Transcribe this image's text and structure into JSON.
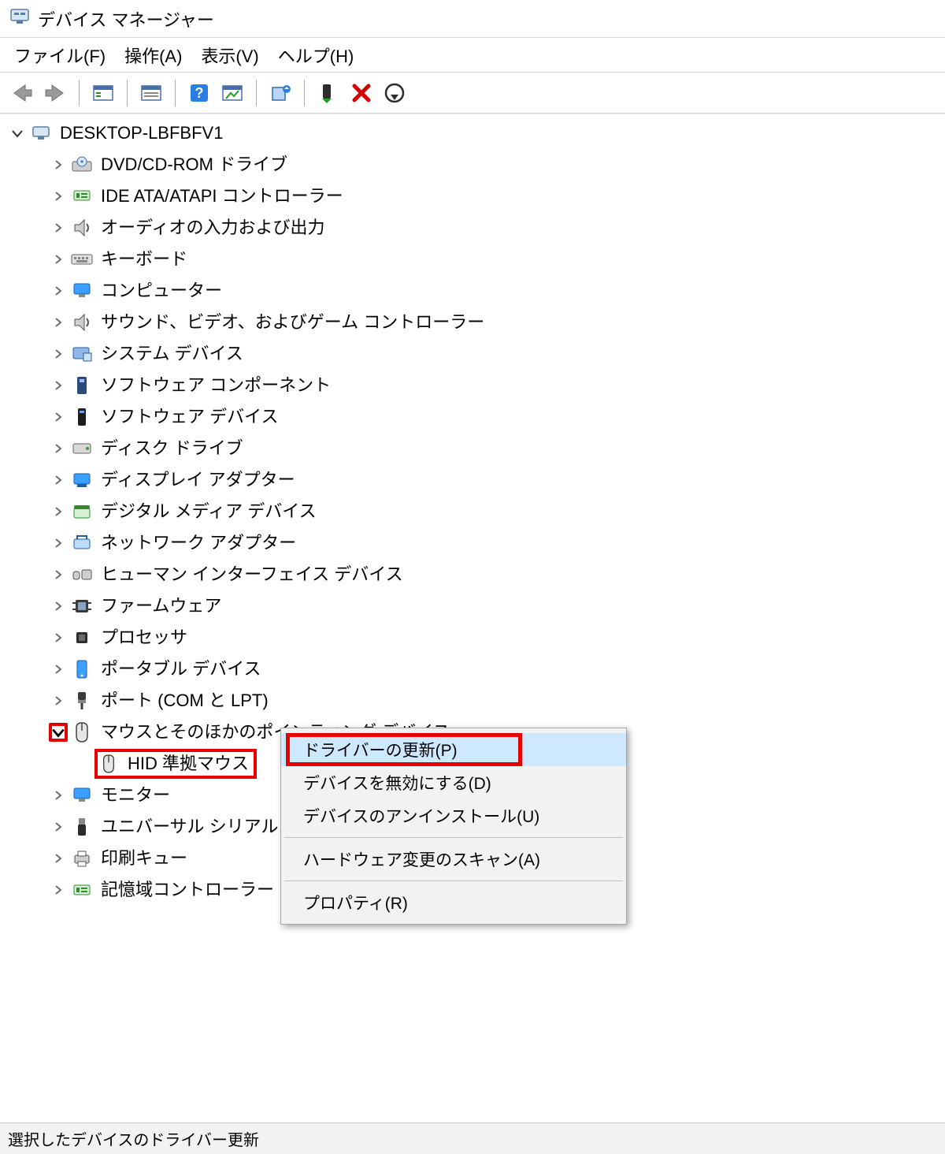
{
  "window": {
    "title": "デバイス マネージャー"
  },
  "menu": {
    "file": "ファイル(F)",
    "action": "操作(A)",
    "view": "表示(V)",
    "help": "ヘルプ(H)"
  },
  "statusbar": {
    "text": "選択したデバイスのドライバー更新"
  },
  "tree": {
    "root": "DESKTOP-LBFBFV1",
    "items": [
      {
        "label": "DVD/CD-ROM ドライブ",
        "icon": "disc-drive-icon"
      },
      {
        "label": "IDE ATA/ATAPI コントローラー",
        "icon": "ide-controller-icon"
      },
      {
        "label": "オーディオの入力および出力",
        "icon": "speaker-icon"
      },
      {
        "label": "キーボード",
        "icon": "keyboard-icon"
      },
      {
        "label": "コンピューター",
        "icon": "computer-icon"
      },
      {
        "label": "サウンド、ビデオ、およびゲーム コントローラー",
        "icon": "speaker-icon"
      },
      {
        "label": "システム デバイス",
        "icon": "system-device-icon"
      },
      {
        "label": "ソフトウェア コンポーネント",
        "icon": "software-component-icon"
      },
      {
        "label": "ソフトウェア デバイス",
        "icon": "software-device-icon"
      },
      {
        "label": "ディスク ドライブ",
        "icon": "disk-drive-icon"
      },
      {
        "label": "ディスプレイ アダプター",
        "icon": "display-adapter-icon"
      },
      {
        "label": "デジタル メディア デバイス",
        "icon": "media-device-icon"
      },
      {
        "label": "ネットワーク アダプター",
        "icon": "network-adapter-icon"
      },
      {
        "label": "ヒューマン インターフェイス デバイス",
        "icon": "hid-icon"
      },
      {
        "label": "ファームウェア",
        "icon": "firmware-icon"
      },
      {
        "label": "プロセッサ",
        "icon": "processor-icon"
      },
      {
        "label": "ポータブル デバイス",
        "icon": "portable-device-icon"
      },
      {
        "label": "ポート (COM と LPT)",
        "icon": "port-icon"
      }
    ],
    "mouse_category": "マウスとそのほかのポインティング デバイス",
    "mouse_child": "HID 準拠マウス",
    "after_items": [
      {
        "label": "モニター",
        "icon": "monitor-icon"
      },
      {
        "label": "ユニバーサル シリアル",
        "icon": "usb-icon"
      },
      {
        "label": "印刷キュー",
        "icon": "printer-icon"
      },
      {
        "label": "記憶域コントローラー",
        "icon": "storage-controller-icon"
      }
    ]
  },
  "context_menu": {
    "update": "ドライバーの更新(P)",
    "disable": "デバイスを無効にする(D)",
    "uninstall": "デバイスのアンインストール(U)",
    "scan": "ハードウェア変更のスキャン(A)",
    "properties": "プロパティ(R)"
  }
}
